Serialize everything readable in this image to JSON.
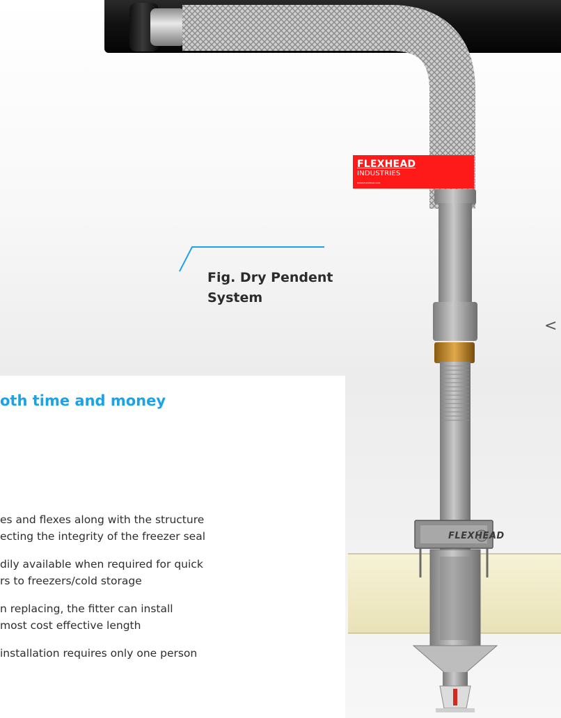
{
  "brand_tag": {
    "line1": "FLEXHEAD",
    "line2": "INDUSTRIES",
    "line3": "WWW.FLEXHEAD.COM",
    "color": "#ff1a1a"
  },
  "caption": {
    "line1": "Fig. Dry Pendent",
    "line2": "System"
  },
  "bracket_label": "FLEXHEAD",
  "heading": "oth time and money",
  "benefits": [
    {
      "line1": "es and flexes along with the structure",
      "line2": "ecting the integrity of the freezer seal"
    },
    {
      "line1": "dily available when required for quick",
      "line2": "rs to freezers/cold storage"
    },
    {
      "line1": "n replacing, the fitter can install",
      "line2": "most cost effective length"
    },
    {
      "line1": "installation requires only one person"
    }
  ],
  "colors": {
    "accent": "#1aa3e8",
    "text": "#2b2b2b",
    "insulation": "#f1ecc9"
  },
  "icons": {
    "edge": "chevron-left-icon"
  }
}
